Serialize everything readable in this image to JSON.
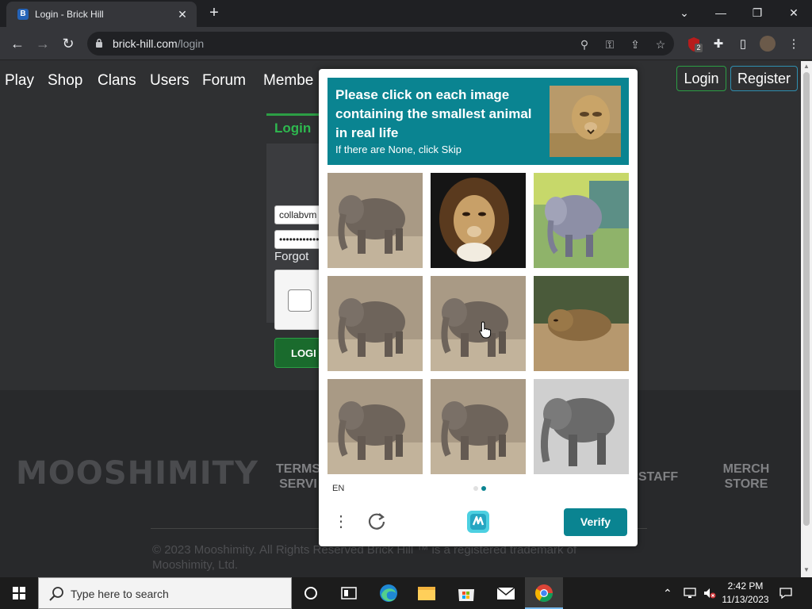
{
  "browser": {
    "tab_title": "Login - Brick Hill",
    "favicon_letter": "B",
    "url_host": "brick-hill.com",
    "url_path": "/login",
    "extension_badge": "2"
  },
  "site": {
    "nav": [
      "Play",
      "Shop",
      "Clans",
      "Users",
      "Forum",
      "Membe"
    ],
    "login_label": "Login",
    "register_label": "Register"
  },
  "login_form": {
    "header": "Login",
    "username_value": "collabvm",
    "password_value": "••••••••••••",
    "forgot_label": "Forgot",
    "submit_label": "LOGI"
  },
  "footer": {
    "logo_text": "MOOSHIMITY",
    "links": [
      {
        "line1": "TERMS",
        "line2": "SERVI"
      },
      {
        "line1": "STAFF",
        "line2": ""
      },
      {
        "line1": "MERCH",
        "line2": "STORE"
      }
    ],
    "copyright": "© 2023 Mooshimity. All Rights Reserved Brick Hill ™ is a registered trademark of Mooshimity, Ltd."
  },
  "captcha": {
    "prompt_line": "Please click on each image containing the smallest animal in real life",
    "prompt_sub": "If there are None, click Skip",
    "tiles": [
      {
        "name": "elephant-photo-1",
        "kind": "elephant"
      },
      {
        "name": "lion-photo",
        "kind": "lion"
      },
      {
        "name": "elephant-painting",
        "kind": "elephant-art"
      },
      {
        "name": "elephant-photo-2",
        "kind": "elephant"
      },
      {
        "name": "elephant-photo-3",
        "kind": "elephant"
      },
      {
        "name": "lioness-lying-photo",
        "kind": "lion-lying"
      },
      {
        "name": "elephant-photo-4",
        "kind": "elephant"
      },
      {
        "name": "elephant-photo-5",
        "kind": "elephant"
      },
      {
        "name": "elephant-bw-photo",
        "kind": "elephant-bw"
      }
    ],
    "language": "EN",
    "verify_label": "Verify",
    "accent": "#0a8491"
  },
  "taskbar": {
    "search_placeholder": "Type here to search",
    "time": "2:42 PM",
    "date": "11/13/2023"
  }
}
